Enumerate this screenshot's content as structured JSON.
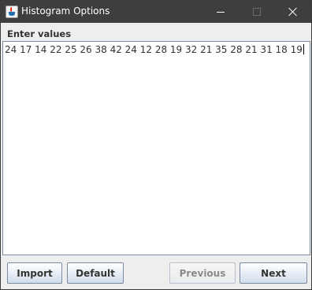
{
  "window": {
    "title": "Histogram Options",
    "app_icon": "java-cup-icon",
    "controls": [
      "minimize-icon",
      "maximize-icon",
      "close-icon"
    ]
  },
  "form": {
    "label": "Enter values",
    "values_text": "24 17 14 22 25 26 38 42 24 12 28 19 32 21 35 28 21 31 18 19"
  },
  "buttons": {
    "import": "Import",
    "default": "Default",
    "previous": "Previous",
    "next": "Next"
  },
  "state": {
    "previous_enabled": false
  }
}
